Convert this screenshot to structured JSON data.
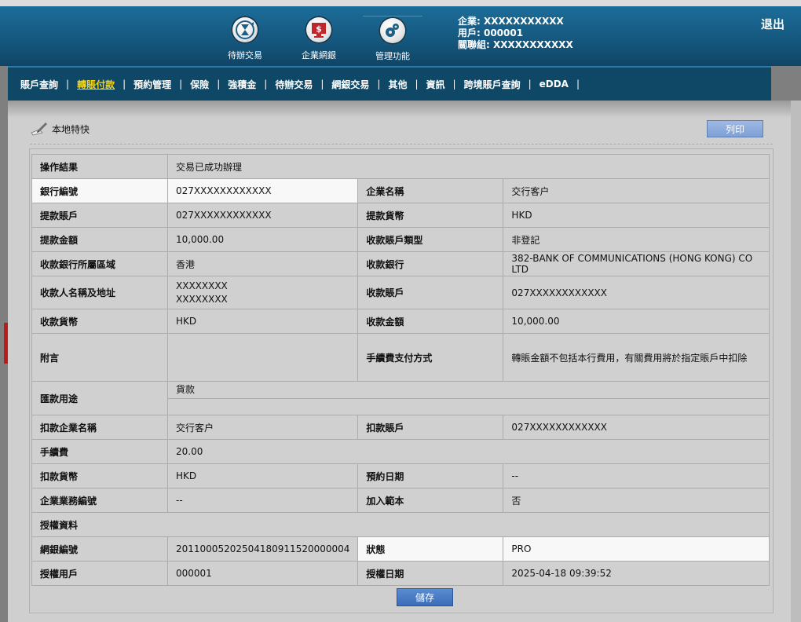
{
  "header": {
    "icons": [
      {
        "label": "待辦交易",
        "icon": "hourglass-icon"
      },
      {
        "label": "企業網銀",
        "icon": "dollar-monitor-icon"
      },
      {
        "label": "管理功能",
        "icon": "gears-icon"
      }
    ],
    "user": {
      "company": "企業: XXXXXXXXXXX",
      "user_id": "用戶: 000001",
      "group": "關聯組: XXXXXXXXXXX"
    },
    "logout": "退出"
  },
  "nav": {
    "items": [
      "賬戶查詢",
      "轉賬付款",
      "預約管理",
      "保險",
      "強積金",
      "待辦交易",
      "網銀交易",
      "其他",
      "資訊",
      "跨境賬戶查詢",
      "eDDA"
    ],
    "active_index": 1
  },
  "page": {
    "title": "本地特快",
    "print": "列印",
    "save": "儲存"
  },
  "fields": {
    "result_label": "操作結果",
    "result_value": "交易已成功辦理",
    "bank_no_label": "銀行編號",
    "bank_no_value": "027XXXXXXXXXXXX",
    "company_name_label": "企業名稱",
    "company_name_value": "交行客户",
    "debit_acct_label": "提款賬戶",
    "debit_acct_value": "027XXXXXXXXXXXX",
    "debit_ccy_label": "提款貨幣",
    "debit_ccy_value": "HKD",
    "debit_amt_label": "提款金額",
    "debit_amt_value": "10,000.00",
    "payee_type_label": "收款賬戶類型",
    "payee_type_value": "非登記",
    "payee_region_label": "收款銀行所屬區域",
    "payee_region_value": "香港",
    "payee_bank_label": "收款銀行",
    "payee_bank_value": "382-BANK OF COMMUNICATIONS (HONG KONG) CO LTD",
    "payee_name_label": "收款人名稱及地址",
    "payee_name_line1": "XXXXXXXX",
    "payee_name_line2": "XXXXXXXX",
    "payee_acct_label": "收款賬戶",
    "payee_acct_value": "027XXXXXXXXXXXX",
    "payee_ccy_label": "收款貨幣",
    "payee_ccy_value": "HKD",
    "payee_amt_label": "收款金額",
    "payee_amt_value": "10,000.00",
    "remark_label": "附言",
    "remark_value": "",
    "fee_method_label": "手續費支付方式",
    "fee_method_value": "轉賬金額不包括本行費用，有關費用將於指定賬戶中扣除",
    "purpose_label": "匯款用途",
    "purpose_value": "貨款",
    "debit_company_label": "扣款企業名稱",
    "debit_company_value": "交行客户",
    "debit_acct2_label": "扣款賬戶",
    "debit_acct2_value": "027XXXXXXXXXXXX",
    "fee_label": "手續費",
    "fee_value": "20.00",
    "debit_ccy2_label": "扣款貨幣",
    "debit_ccy2_value": "HKD",
    "schedule_label": "預約日期",
    "schedule_value": "--",
    "biz_no_label": "企業業務編號",
    "biz_no_value": "--",
    "template_label": "加入範本",
    "template_value": "否",
    "auth_section_label": "授權資料",
    "netbank_no_label": "網銀編號",
    "netbank_no_value": "20110005202504180911520000004",
    "status_label": "狀態",
    "status_value": "PRO",
    "auth_user_label": "授權用戶",
    "auth_user_value": "000001",
    "auth_date_label": "授權日期",
    "auth_date_value": "2025-04-18 09:39:52"
  }
}
